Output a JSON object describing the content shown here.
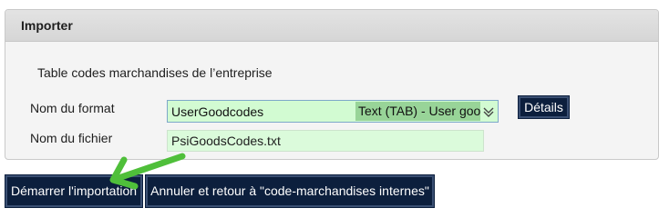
{
  "importer": {
    "title": "Importer",
    "subtitle": "Table codes marchandises de l’entreprise",
    "format_label": "Nom du format",
    "format_value": "UserGoodcodes",
    "format_type": "Text (TAB) - User goo",
    "details_button": "Détails",
    "file_label": "Nom du fichier",
    "file_value": "PsiGoodsCodes.txt"
  },
  "actions": {
    "start_import": "Démarrer l'importation",
    "cancel_return": "Annuler et retour à \"code-marchandises internes\""
  },
  "colors": {
    "button_bg": "#0c1f3d",
    "field_green": "#d2fbd2",
    "field_green_dark": "#98d498",
    "arrow_green": "#4fbf3a"
  },
  "icons": {
    "select": "chevron-down-icon",
    "annotation": "annotation-arrow-icon"
  }
}
